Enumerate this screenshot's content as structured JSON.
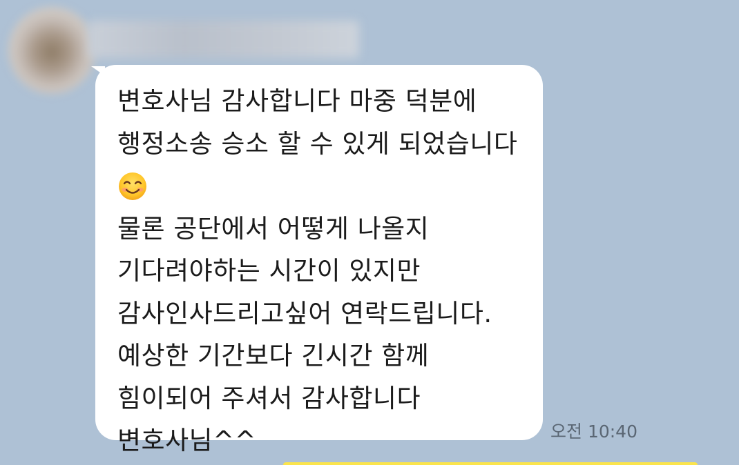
{
  "chat": {
    "sender": {
      "avatar": "blurred-avatar",
      "name": ""
    },
    "message": {
      "lines_before_emoji": [
        "변호사님 감사합니다 마중 덕분에",
        "행정소송 승소 할 수 있게 되었습니다"
      ],
      "emoji": "smiling-face-icon",
      "lines_after_emoji": [
        "물론 공단에서 어떻게 나올지",
        "기다려야하는 시간이 있지만",
        "감사인사드리고싶어 연락드립니다.",
        "예상한 기간보다 긴시간 함께",
        "힘이되어 주셔서 감사합니다",
        "변호사님^^"
      ],
      "time": "오전 10:40"
    },
    "colors": {
      "background": "#aec1d5",
      "bubble": "#ffffff",
      "text": "#1b1b1b",
      "timestamp": "#5a6673",
      "my_bubble": "#fbe44c"
    }
  }
}
